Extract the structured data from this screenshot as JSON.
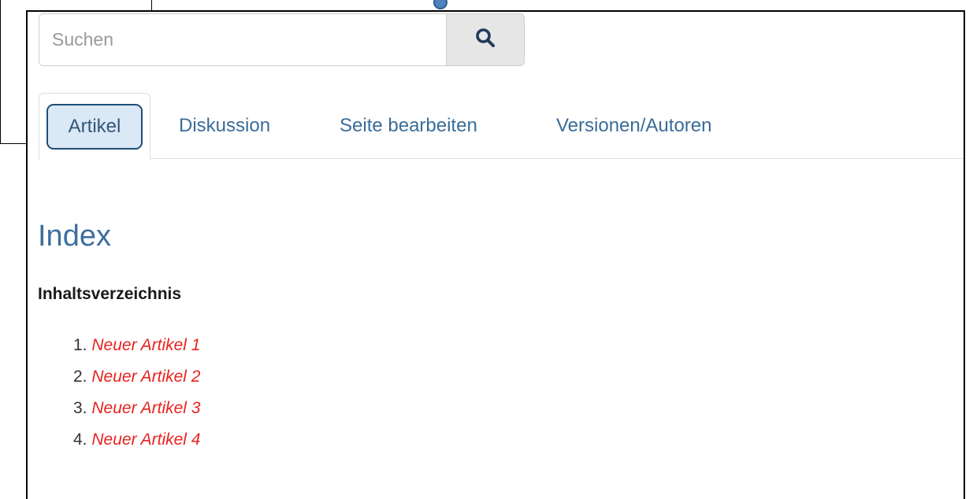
{
  "search": {
    "placeholder": "Suchen",
    "button_icon": "search-icon"
  },
  "tabs": [
    {
      "label": "Artikel",
      "active": true
    },
    {
      "label": "Diskussion",
      "active": false
    },
    {
      "label": "Seite bearbeiten",
      "active": false
    },
    {
      "label": "Versionen/Autoren",
      "active": false
    }
  ],
  "page": {
    "title": "Index",
    "toc_heading": "Inhaltsverzeichnis",
    "toc_items": [
      {
        "number": "1.",
        "label": "Neuer Artikel 1"
      },
      {
        "number": "2.",
        "label": "Neuer Artikel 2"
      },
      {
        "number": "3.",
        "label": "Neuer Artikel 3"
      },
      {
        "number": "4.",
        "label": "Neuer Artikel 4"
      }
    ]
  },
  "colors": {
    "link_missing": "#e8221f",
    "title": "#3d6f9e",
    "active_tab_highlight": "#dbe8f5"
  }
}
